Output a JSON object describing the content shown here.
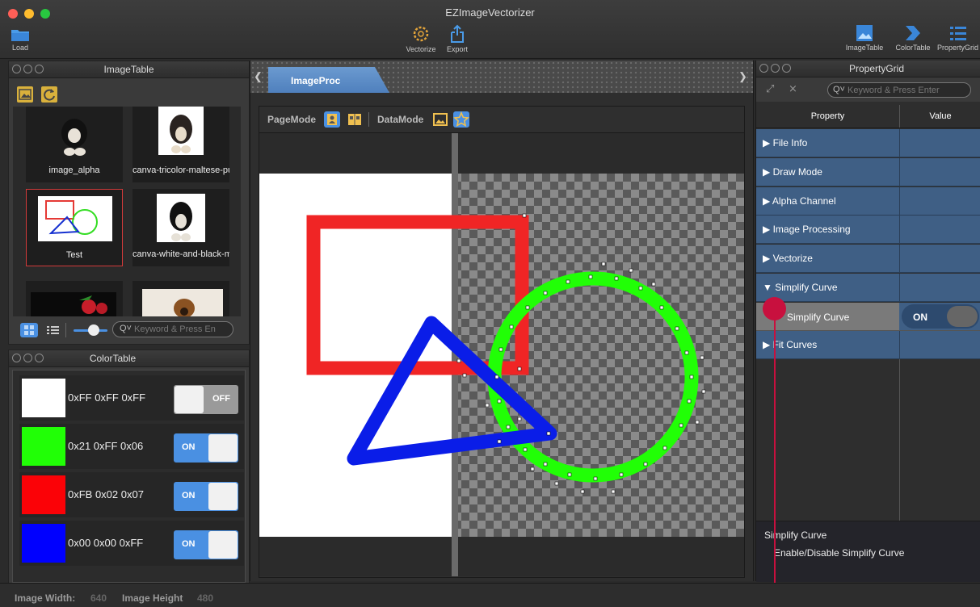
{
  "window": {
    "title": "EZImageVectorizer"
  },
  "toolbar": {
    "load": "Load",
    "vectorize": "Vectorize",
    "export": "Export",
    "imagetable": "ImageTable",
    "colortable": "ColorTable",
    "propertygrid": "PropertyGrid"
  },
  "imageTable": {
    "title": "ImageTable",
    "thumbs": [
      "image_alpha",
      "canva-tricolor-maltese-pu...",
      "Test",
      "canva-white-and-black-m..."
    ],
    "search_placeholder": "Keyword & Press En"
  },
  "colorTable": {
    "title": "ColorTable",
    "rows": [
      {
        "label": "0xFF 0xFF 0xFF",
        "color": "#FFFFFF",
        "state": "OFF"
      },
      {
        "label": "0x21 0xFF 0x06",
        "color": "#21FF06",
        "state": "ON"
      },
      {
        "label": "0xFB 0x02 0x07",
        "color": "#FB0207",
        "state": "ON"
      },
      {
        "label": "0x00 0x00 0xFF",
        "color": "#0000FF",
        "state": "ON"
      }
    ]
  },
  "center": {
    "tab": "ImageProc",
    "pagemode": "PageMode",
    "datamode": "DataMode"
  },
  "propertyGrid": {
    "title": "PropertyGrid",
    "search_placeholder": "Keyword & Press Enter",
    "col_property": "Property",
    "col_value": "Value",
    "groups": [
      "File Info",
      "Draw Mode",
      "Alpha Channel",
      "Image Processing",
      "Vectorize",
      "Simplify Curve",
      "Fit Curves"
    ],
    "selected_item": {
      "label": "Simplify Curve",
      "value": "ON"
    },
    "desc_title": "Simplify Curve",
    "desc_text": "Enable/Disable Simplify Curve"
  },
  "status": {
    "width_label": "Image Width:",
    "width_value": "640",
    "height_label": "Image Height",
    "height_value": "480"
  },
  "colors": {
    "accent": "#4A90E2",
    "selected_row": "#3F5F85",
    "marker": "#C8103E"
  }
}
